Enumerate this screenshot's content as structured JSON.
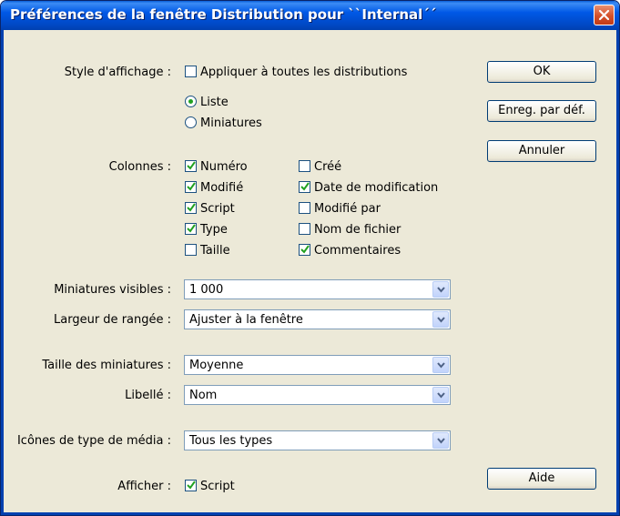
{
  "window": {
    "title": "Préférences de la fenêtre Distribution pour ``Internal´´"
  },
  "display_style": {
    "label": "Style d'affichage :",
    "apply_all": {
      "label": "Appliquer à toutes les distributions",
      "checked": false
    },
    "options": [
      {
        "label": "Liste",
        "selected": true
      },
      {
        "label": "Miniatures",
        "selected": false
      }
    ]
  },
  "columns": {
    "label": "Colonnes :",
    "left": [
      {
        "label": "Numéro",
        "checked": true
      },
      {
        "label": "Modifié",
        "checked": true
      },
      {
        "label": "Script",
        "checked": true
      },
      {
        "label": "Type",
        "checked": true
      },
      {
        "label": "Taille",
        "checked": false
      }
    ],
    "right": [
      {
        "label": "Créé",
        "checked": false
      },
      {
        "label": "Date de modification",
        "checked": true
      },
      {
        "label": "Modifié par",
        "checked": false
      },
      {
        "label": "Nom de fichier",
        "checked": false
      },
      {
        "label": "Commentaires",
        "checked": true
      }
    ]
  },
  "fields": {
    "visible_thumbs": {
      "label": "Miniatures visibles :",
      "value": "1 000"
    },
    "row_width": {
      "label": "Largeur de rangée :",
      "value": "Ajuster à la fenêtre"
    },
    "thumb_size": {
      "label": "Taille des miniatures :",
      "value": "Moyenne"
    },
    "caption": {
      "label": "Libellé :",
      "value": "Nom"
    },
    "media_icons": {
      "label": "Icônes de type de média :",
      "value": "Tous les types"
    }
  },
  "show": {
    "label": "Afficher :",
    "script": {
      "label": "Script",
      "checked": true
    }
  },
  "buttons": {
    "ok": "OK",
    "save_default": "Enreg. par déf.",
    "cancel": "Annuler",
    "help": "Aide"
  },
  "colors": {
    "titlebar": "#0058e6",
    "dialog_bg": "#ece9d8",
    "check_green": "#21a121",
    "close_red": "#d5502a"
  }
}
